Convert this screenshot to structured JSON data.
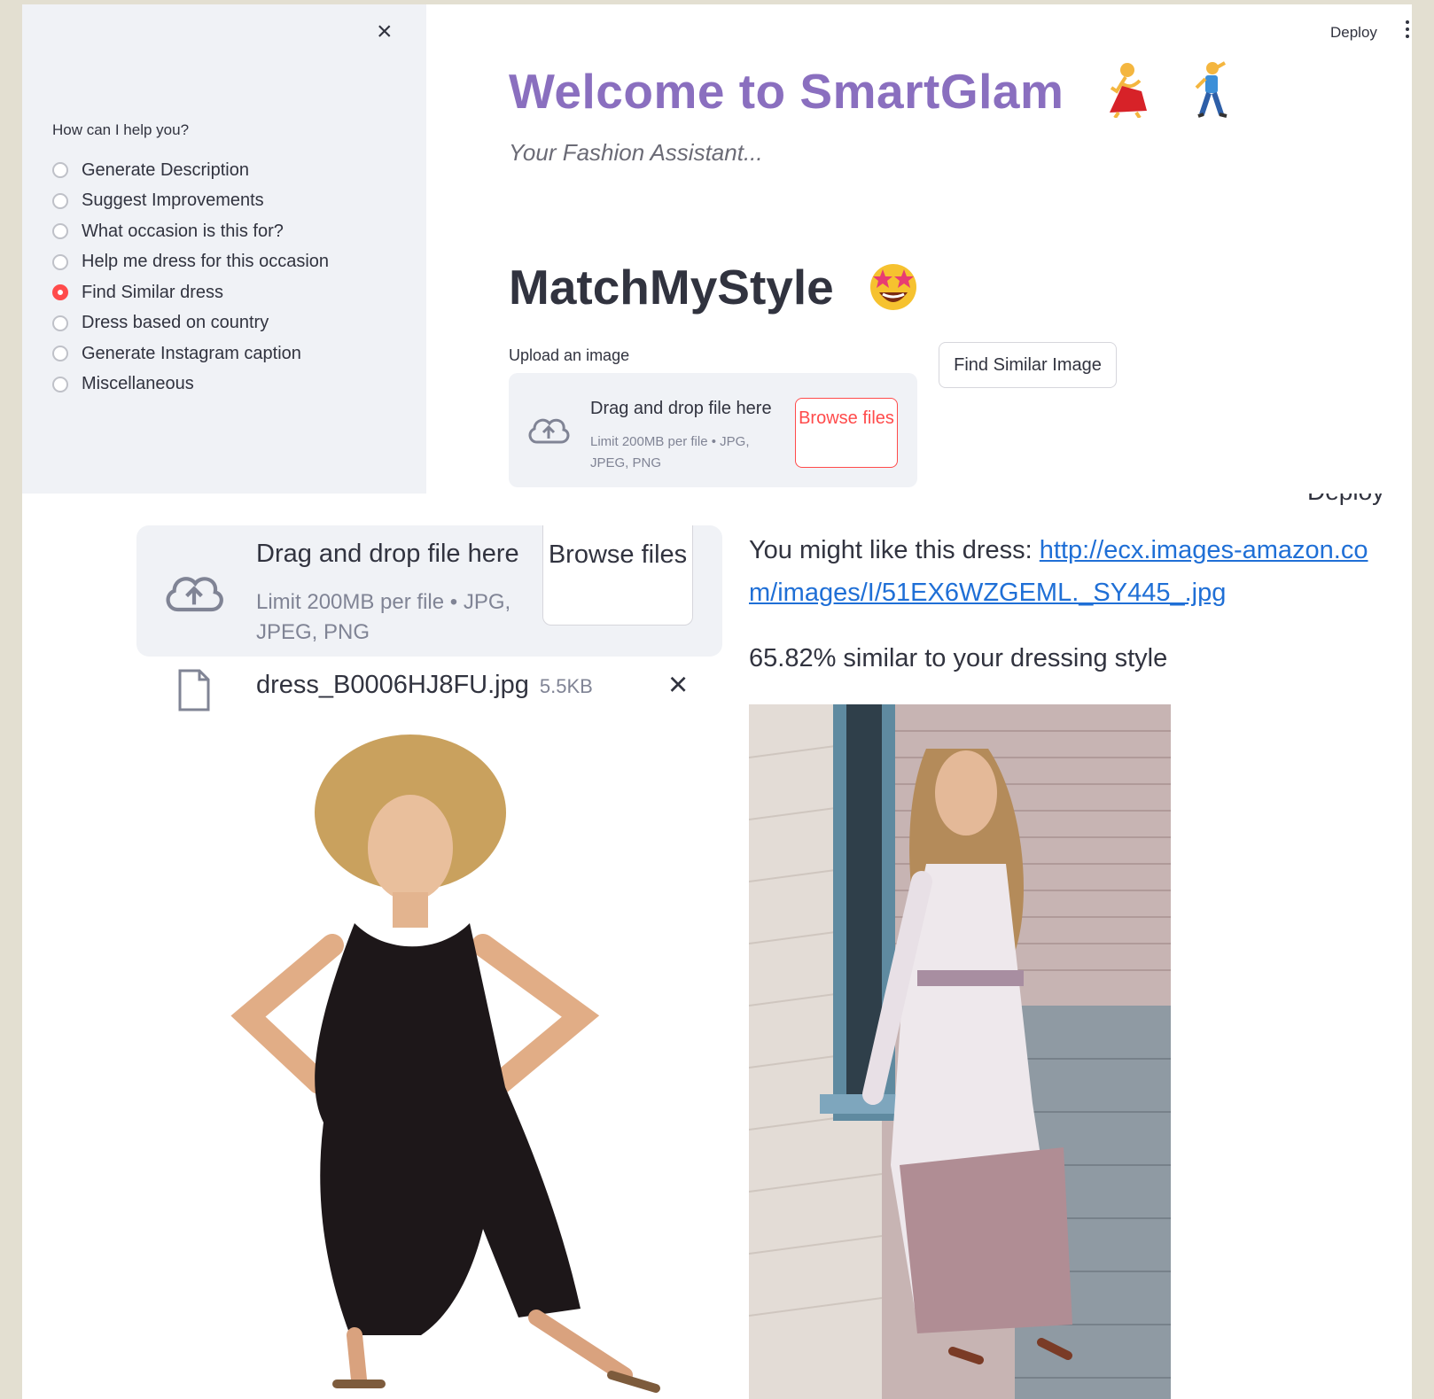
{
  "sidebar": {
    "close_label": "×",
    "radio_label": "How can I help you?",
    "options": [
      "Generate Description",
      "Suggest Improvements",
      "What occasion is this for?",
      "Help me dress for this occasion",
      "Find Similar dress",
      "Dress based on country",
      "Generate Instagram caption",
      "Miscellaneous"
    ],
    "selected": "Find Similar dress"
  },
  "header": {
    "deploy_label": "Deploy"
  },
  "main": {
    "title": "Welcome to SmartGlam",
    "subtitle": "Your Fashion Assistant...",
    "section_title": "MatchMyStyle",
    "upload_label": "Upload an image",
    "find_button": "Find Similar Image"
  },
  "uploader": {
    "drop_title": "Drag and drop file here",
    "limit_text": "Limit 200MB per file • JPG, JPEG, PNG",
    "browse_label": "Browse files"
  },
  "uploaded_file": {
    "name": "dress_B0006HJ8FU.jpg",
    "size": "5.5KB",
    "remove_label": "×"
  },
  "result": {
    "suggest_prefix": "You might like this dress:",
    "suggest_link": "http://ecx.images-amazon.com/images/I/51EX6WZGEML._SY445_.jpg",
    "similarity_text": "65.82% similar to your dressing style"
  },
  "colors": {
    "accent": "#ff4b4b",
    "title_purple": "#8a6fbf",
    "link": "#1f6fd6",
    "sidebar_bg": "#f0f2f6"
  }
}
